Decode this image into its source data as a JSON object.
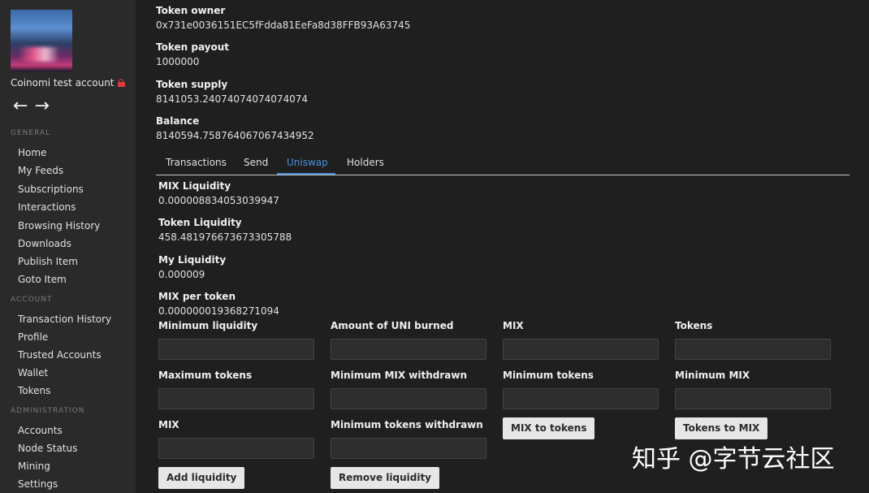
{
  "sidebar": {
    "account_name": "Coinomi test account",
    "sections": {
      "general": "GENERAL",
      "account": "ACCOUNT",
      "administration": "ADMINISTRATION"
    },
    "general_items": [
      "Home",
      "My Feeds",
      "Subscriptions",
      "Interactions",
      "Browsing History",
      "Downloads",
      "Publish Item",
      "Goto Item"
    ],
    "account_items": [
      "Transaction History",
      "Profile",
      "Trusted Accounts",
      "Wallet",
      "Tokens"
    ],
    "admin_items": [
      "Accounts",
      "Node Status",
      "Mining",
      "Settings"
    ],
    "back_arrow": "←",
    "forward_arrow": "→"
  },
  "token": {
    "owner_label": "Token owner",
    "owner_value": "0x731e0036151EC5fFdda81EeFa8d38FFB93A63745",
    "payout_label": "Token payout",
    "payout_value": "1000000",
    "supply_label": "Token supply",
    "supply_value": "8141053.24074074074074074",
    "balance_label": "Balance",
    "balance_value": "8140594.758764067067434952"
  },
  "tabs": [
    "Transactions",
    "Send",
    "Uniswap",
    "Holders"
  ],
  "active_tab": "Uniswap",
  "uniswap": {
    "mix_liquidity_label": "MIX Liquidity",
    "mix_liquidity_value": "0.000008834053039947",
    "token_liquidity_label": "Token Liquidity",
    "token_liquidity_value": "458.481976673673305788",
    "my_liquidity_label": "My Liquidity",
    "my_liquidity_value": "0.000009",
    "mix_per_token_label": "MIX per token",
    "mix_per_token_value": "0.000000019368271094"
  },
  "form": {
    "add": {
      "min_liquidity_label": "Minimum liquidity",
      "max_tokens_label": "Maximum tokens",
      "mix_label": "MIX",
      "button": "Add liquidity"
    },
    "remove": {
      "uni_burned_label": "Amount of UNI burned",
      "min_mix_label": "Minimum MIX withdrawn",
      "min_tokens_label": "Minimum tokens withdrawn",
      "button": "Remove liquidity"
    },
    "mix_to_tokens": {
      "mix_label": "MIX",
      "min_tokens_label": "Minimum tokens",
      "button": "MIX to tokens"
    },
    "tokens_to_mix": {
      "tokens_label": "Tokens",
      "min_mix_label": "Minimum MIX",
      "button": "Tokens to MIX"
    }
  },
  "watermark": "知乎 @字节云社区"
}
